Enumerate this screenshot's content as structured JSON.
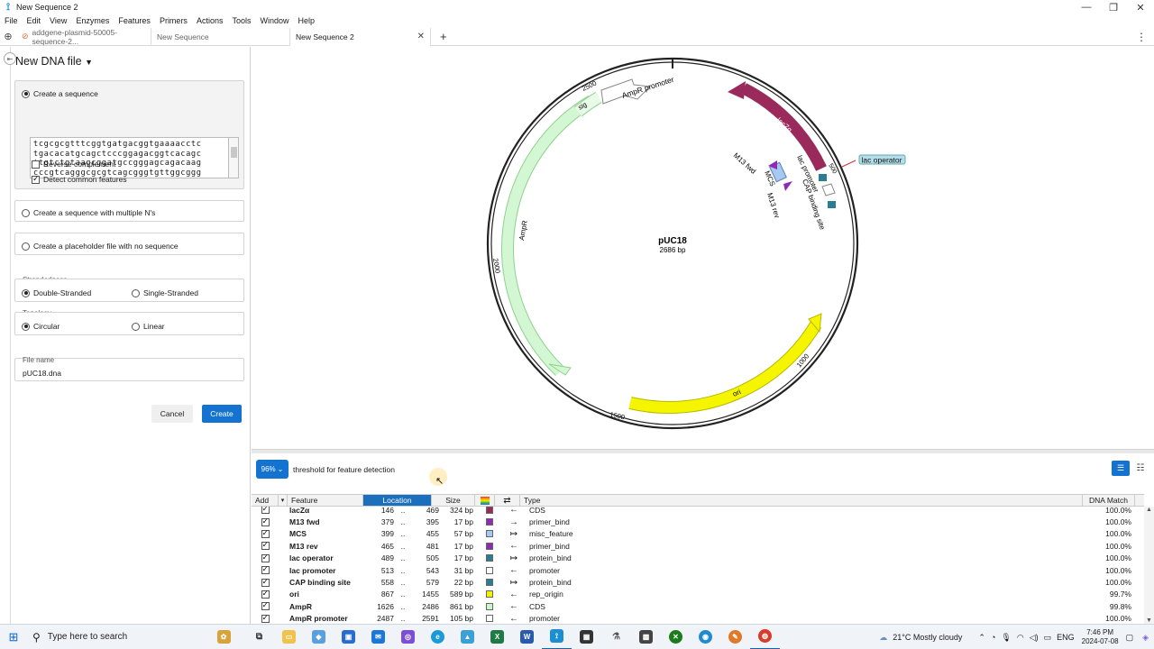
{
  "window": {
    "title": "New Sequence 2"
  },
  "menu": [
    "File",
    "Edit",
    "View",
    "Enzymes",
    "Features",
    "Primers",
    "Actions",
    "Tools",
    "Window",
    "Help"
  ],
  "tabs": [
    {
      "label": "addgene-plasmid-50005-sequence-2..."
    },
    {
      "label": "New Sequence"
    },
    {
      "label": "New Sequence 2"
    }
  ],
  "panel": {
    "title": "New DNA file",
    "create_sequence": "Create a sequence",
    "sequence_lines": [
      "tcgcgcgtttcggtgatgacggtgaaaacctc",
      "tgacacatgcagctcccggagacggtcacagc",
      "ttgtctgtaagcggatgccgggagcagacaag",
      "cccgtcagggcgcgtcagcgggtgttggcggg"
    ],
    "reverse_complement": "Reverse complement",
    "detect_features": "Detect common features",
    "multiple_n": "Create a sequence with multiple N's",
    "placeholder": "Create a placeholder file with no sequence",
    "strandedness_label": "Strandedness",
    "double_stranded": "Double-Stranded",
    "single_stranded": "Single-Stranded",
    "topology_label": "Topology",
    "circular": "Circular",
    "linear": "Linear",
    "file_name_label": "File name",
    "file_name": "pUC18.dna",
    "cancel": "Cancel",
    "create": "Create"
  },
  "map": {
    "name": "pUC18",
    "length": "2686 bp",
    "ticks": [
      "2500",
      "2000",
      "1500",
      "1000",
      "500"
    ],
    "features": {
      "ampr_promoter": "AmpR promoter",
      "sig": "sig",
      "ampr": "AmpR",
      "ori": "ori",
      "lacza": "lacZα",
      "lac_promoter": "lac promoter",
      "cap": "CAP binding site",
      "m13fwd": "M13 fwd",
      "mcs": "MCS",
      "m13rev": "M13 rev",
      "lac_operator": "lac operator"
    }
  },
  "threshold": {
    "value": "96%",
    "label": "threshold for feature detection"
  },
  "table": {
    "headers": {
      "add": "Add",
      "feature": "Feature",
      "location": "Location",
      "size": "Size",
      "type": "Type",
      "match": "DNA Match"
    },
    "rows": [
      {
        "feature": "lacZα",
        "start": "146",
        "end": "469",
        "size": "324 bp",
        "color": "#9b2a5c",
        "dir": "←",
        "type": "CDS",
        "match": "100.0%"
      },
      {
        "feature": "M13 fwd",
        "start": "379",
        "end": "395",
        "size": "17 bp",
        "color": "#8d2bb5",
        "dir": "→",
        "type": "primer_bind",
        "match": "100.0%"
      },
      {
        "feature": "MCS",
        "start": "399",
        "end": "455",
        "size": "57 bp",
        "color": "#a7c8f0",
        "dir": "↦",
        "type": "misc_feature",
        "match": "100.0%"
      },
      {
        "feature": "M13 rev",
        "start": "465",
        "end": "481",
        "size": "17 bp",
        "color": "#8d2bb5",
        "dir": "←",
        "type": "primer_bind",
        "match": "100.0%"
      },
      {
        "feature": "lac operator",
        "start": "489",
        "end": "505",
        "size": "17 bp",
        "color": "#2b7e91",
        "dir": "↦",
        "type": "protein_bind",
        "match": "100.0%"
      },
      {
        "feature": "lac promoter",
        "start": "513",
        "end": "543",
        "size": "31 bp",
        "color": "#ffffff",
        "dir": "←",
        "type": "promoter",
        "match": "100.0%"
      },
      {
        "feature": "CAP binding site",
        "start": "558",
        "end": "579",
        "size": "22 bp",
        "color": "#2b7e91",
        "dir": "↦",
        "type": "protein_bind",
        "match": "100.0%"
      },
      {
        "feature": "ori",
        "start": "867",
        "end": "1455",
        "size": "589 bp",
        "color": "#f2f200",
        "dir": "←",
        "type": "rep_origin",
        "match": "99.7%"
      },
      {
        "feature": "AmpR",
        "start": "1626",
        "end": "2486",
        "size": "861 bp",
        "color": "#c9f5c9",
        "dir": "←",
        "type": "CDS",
        "match": "99.8%"
      },
      {
        "feature": "AmpR promoter",
        "start": "2487",
        "end": "2591",
        "size": "105 bp",
        "color": "#ffffff",
        "dir": "←",
        "type": "promoter",
        "match": "100.0%"
      }
    ]
  },
  "taskbar": {
    "search_placeholder": "Type here to search",
    "weather": "21°C  Mostly cloudy",
    "lang": "ENG",
    "time": "7:46 PM",
    "date": "2024-07-08"
  }
}
